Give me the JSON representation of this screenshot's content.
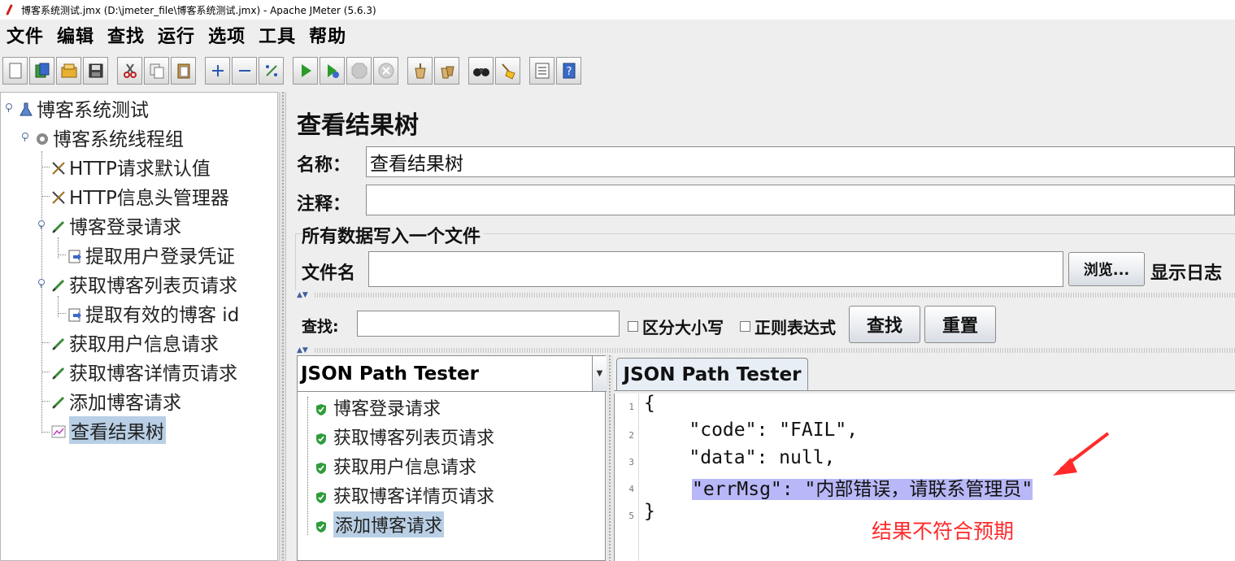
{
  "window": {
    "title": "博客系统测试.jmx (D:\\jmeter_file\\博客系统测试.jmx) - Apache JMeter (5.6.3)"
  },
  "menu": [
    "文件",
    "编辑",
    "查找",
    "运行",
    "选项",
    "工具",
    "帮助"
  ],
  "toolbar": {
    "buttons": [
      "new-icon",
      "templates-icon",
      "open-icon",
      "save-icon",
      "cut-icon",
      "copy-icon",
      "paste-icon",
      "expand-icon",
      "collapse-icon",
      "toggle-icon",
      "start-icon",
      "start-no-pauses-icon",
      "stop-icon",
      "shutdown-icon",
      "clear-icon",
      "clear-all-icon",
      "search-icon",
      "reset-search-icon",
      "function-helper-icon",
      "help-icon"
    ]
  },
  "tree": {
    "nodes": [
      {
        "label": "博客系统测试",
        "icon": "test-plan-icon"
      },
      {
        "label": "博客系统线程组",
        "icon": "thread-group-icon"
      },
      {
        "label": "HTTP请求默认值",
        "icon": "config-element-icon"
      },
      {
        "label": "HTTP信息头管理器",
        "icon": "config-element-icon"
      },
      {
        "label": "博客登录请求",
        "icon": "sampler-icon"
      },
      {
        "label": "提取用户登录凭证",
        "icon": "post-processor-icon"
      },
      {
        "label": "获取博客列表页请求",
        "icon": "sampler-icon"
      },
      {
        "label": "提取有效的博客 id",
        "icon": "post-processor-icon"
      },
      {
        "label": "获取用户信息请求",
        "icon": "sampler-icon"
      },
      {
        "label": "获取博客详情页请求",
        "icon": "sampler-icon"
      },
      {
        "label": "添加博客请求",
        "icon": "sampler-icon"
      },
      {
        "label": "查看结果树",
        "icon": "listener-icon"
      }
    ],
    "selected": "查看结果树"
  },
  "panel": {
    "title": "查看结果树",
    "name_label": "名称：",
    "name_value": "查看结果树",
    "comment_label": "注释：",
    "comment_value": "",
    "file_group_title": "所有数据写入一个文件",
    "filename_label": "文件名",
    "filename_value": "",
    "browse_button": "浏览...",
    "log_label": "显示日志"
  },
  "search": {
    "label": "查找:",
    "value": "",
    "case_sensitive_label": "区分大小写",
    "case_sensitive": false,
    "regex_label": "正则表达式",
    "regex": false,
    "find_button": "查找",
    "reset_button": "重置"
  },
  "results": {
    "renderer": "JSON Path Tester",
    "items": [
      "博客登录请求",
      "获取博客列表页请求",
      "获取用户信息请求",
      "获取博客详情页请求",
      "添加博客请求"
    ],
    "selected": "添加博客请求",
    "status_color": "#2e9c3a"
  },
  "viewer": {
    "tab_label": "JSON Path Tester",
    "line_numbers": [
      "1",
      "2",
      "3",
      "4",
      "5"
    ],
    "lines": [
      "{",
      "    \"code\": \"FAIL\",",
      "    \"data\": null,",
      "\"errMsg\": \"内部错误，请联系管理员\"",
      "}"
    ],
    "highlighted_line": 4
  },
  "annotation": {
    "text": "结果不符合预期",
    "color": "#ff2a2a"
  }
}
